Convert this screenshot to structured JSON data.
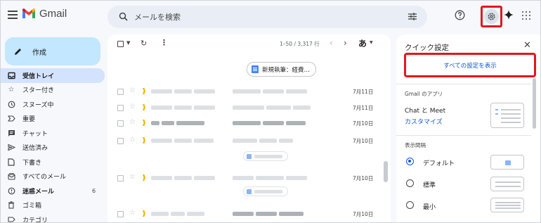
{
  "header": {
    "app_name": "Gmail",
    "search_placeholder": "メールを検索",
    "icons": [
      "menu-icon",
      "gmail-logo",
      "search-icon",
      "filter-icon",
      "help-icon",
      "settings-gear-icon",
      "gemini-spark-icon",
      "apps-grid-icon"
    ]
  },
  "sidebar": {
    "compose_label": "作成",
    "items": [
      {
        "label": "受信トレイ",
        "icon": "inbox-icon",
        "active": true
      },
      {
        "label": "スター付き",
        "icon": "star-icon"
      },
      {
        "label": "スヌーズ中",
        "icon": "clock-icon"
      },
      {
        "label": "重要",
        "icon": "important-icon"
      },
      {
        "label": "チャット",
        "icon": "chat-icon"
      },
      {
        "label": "送信済み",
        "icon": "send-icon"
      },
      {
        "label": "下書き",
        "icon": "draft-icon"
      },
      {
        "label": "すべてのメール",
        "icon": "all-mail-icon"
      },
      {
        "label": "迷惑メール",
        "icon": "spam-icon",
        "bold": true,
        "count": "6"
      },
      {
        "label": "ゴミ箱",
        "icon": "trash-icon"
      },
      {
        "label": "カテゴリ",
        "icon": "category-icon"
      }
    ]
  },
  "toolbar": {
    "range": "1–50 / 3,317 行",
    "sort_label": "あ"
  },
  "list": {
    "chip_label": "新規執筆：経費…",
    "rows": [
      {
        "date": "7月11日"
      },
      {
        "date": "7月11日"
      },
      {
        "date": "7月10日"
      },
      {
        "date": "7月10日"
      },
      {
        "date": "7月10日"
      },
      {
        "date": "7月10日"
      }
    ]
  },
  "quick_settings": {
    "title": "クイック設定",
    "all_settings_button": "すべての設定を表示",
    "apps_section": "Gmail のアプリ",
    "chat_meet": "Chat と Meet",
    "customize": "カスタマイズ",
    "density_section": "表示間隔",
    "density_options": [
      {
        "label": "デフォルト",
        "selected": true
      },
      {
        "label": "標準",
        "selected": false
      },
      {
        "label": "最小",
        "selected": false
      }
    ]
  },
  "colors": {
    "highlight_red": "#e5161d",
    "link_blue": "#0b57d0",
    "compose_bg": "#c2e7ff",
    "active_nav_bg": "#d3e3fd"
  }
}
